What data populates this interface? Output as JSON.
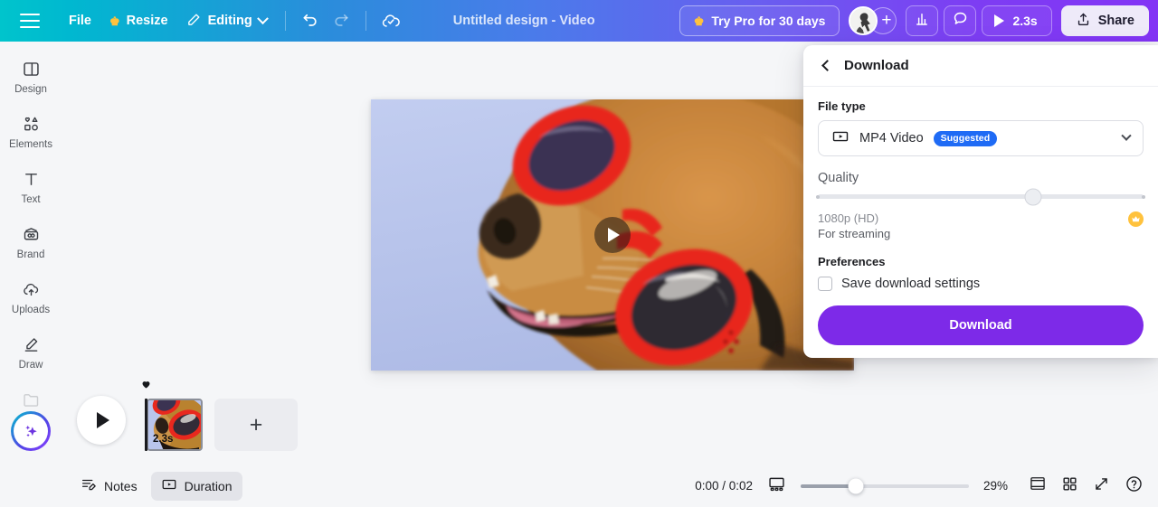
{
  "topbar": {
    "menu_icon": "hamburger-icon",
    "file_label": "File",
    "resize_label": "Resize",
    "resize_icon": "crown-icon",
    "editing_label": "Editing",
    "editing_icon": "pencil-icon",
    "undo_icon": "undo-icon",
    "redo_icon": "redo-icon",
    "cloud_save_icon": "cloud-check-icon",
    "doc_title": "Untitled design - Video",
    "try_pro_label": "Try Pro for 30 days",
    "try_pro_icon": "crown-icon",
    "avatar_name": "avatar",
    "add_member_label": "+",
    "insights_icon": "bar-chart-icon",
    "comments_icon": "comment-icon",
    "preview_duration": "2.3s",
    "preview_icon": "play-icon",
    "share_label": "Share",
    "share_icon": "share-upload-icon",
    "gradient_start": "#00c4cc",
    "gradient_end": "#8334f5"
  },
  "sidebar": {
    "items": [
      {
        "label": "Design",
        "icon": "design-panels-icon"
      },
      {
        "label": "Elements",
        "icon": "shapes-icon"
      },
      {
        "label": "Text",
        "icon": "text-t-icon"
      },
      {
        "label": "Brand",
        "icon": "brand-kit-icon"
      },
      {
        "label": "Uploads",
        "icon": "upload-cloud-icon"
      },
      {
        "label": "Draw",
        "icon": "pencil-draw-icon"
      }
    ],
    "magic_button_icon": "magic-sparkles-icon"
  },
  "canvas": {
    "page_play_icon": "play-overlay-icon",
    "background_color": "#b9c5ec",
    "description": "Golden retriever dog wearing red goggles"
  },
  "timeline": {
    "play_icon": "play-icon",
    "clip_duration": "2.3s",
    "favorite_icon": "heart-icon",
    "add_page_label": "+"
  },
  "bottombar": {
    "notes_label": "Notes",
    "notes_icon": "notes-icon",
    "duration_label": "Duration",
    "duration_icon": "duration-video-icon",
    "timecode": "0:00 / 0:02",
    "fit_icon": "fit-page-icon",
    "zoom_percent": "29%",
    "zoom_value": 29,
    "page_view_icon": "single-page-icon",
    "grid_view_icon": "grid-view-icon",
    "fullscreen_icon": "expand-fullscreen-icon",
    "help_icon": "help-question-icon"
  },
  "download_panel": {
    "back_icon": "back-chevron-icon",
    "title": "Download",
    "file_type_label": "File type",
    "file_type_value": "MP4 Video",
    "file_type_icon": "video-file-icon",
    "file_type_badge": "Suggested",
    "file_type_chevron": "chevron-down-icon",
    "quality_label": "Quality",
    "quality_slider_value": 66,
    "quality_name": "1080p (HD)",
    "quality_sub": "For streaming",
    "quality_pro_icon": "crown-icon",
    "preferences_label": "Preferences",
    "save_settings_label": "Save download settings",
    "save_settings_checked": false,
    "download_button_label": "Download",
    "accent_color": "#7d2ae8",
    "badge_color": "#1f6bf5"
  }
}
